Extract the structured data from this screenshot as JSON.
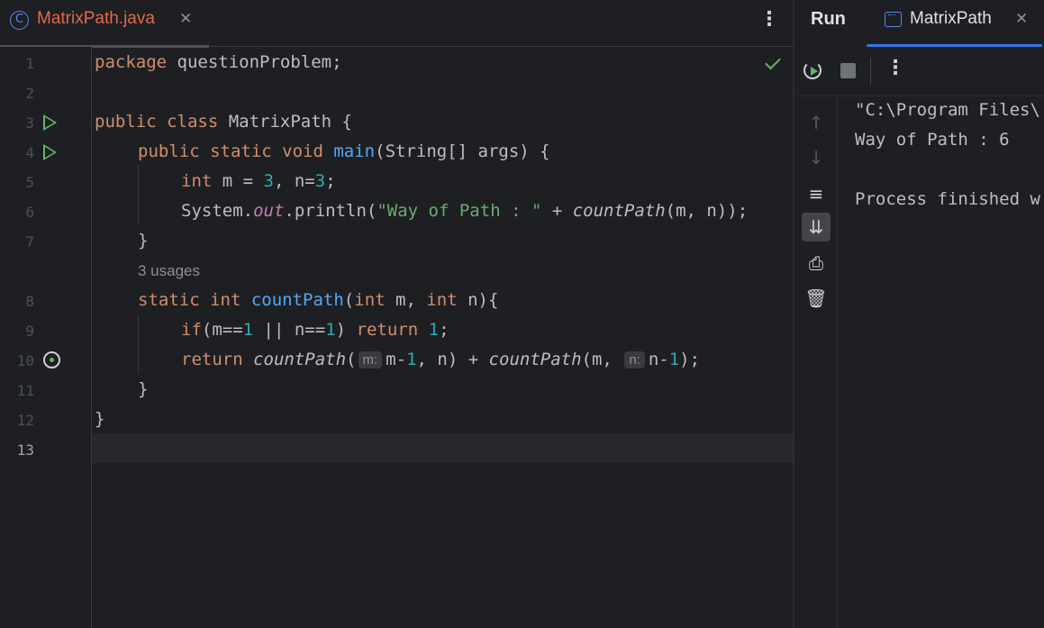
{
  "editor": {
    "file_tab": {
      "icon_letter": "C",
      "name": "MatrixPath.java",
      "close": "✕"
    },
    "menu": "⋮",
    "line_numbers": [
      "1",
      "2",
      "3",
      "4",
      "5",
      "6",
      "7",
      "8",
      "9",
      "10",
      "11",
      "12",
      "13"
    ],
    "code": {
      "l1": {
        "kw": "package",
        "rest": " questionProblem;"
      },
      "l3": {
        "kw": "public class",
        "rest": " MatrixPath {"
      },
      "l4": {
        "kw": "public static void",
        "fn": "main",
        "rest": "(String[] args) {"
      },
      "l5": {
        "kw": "int",
        "a": " m = ",
        "n1": "3",
        "b": ", n=",
        "n2": "3",
        "c": ";"
      },
      "l6": {
        "a": "System.",
        "field": "out",
        "b": ".println(",
        "str": "\"Way of Path : \"",
        "c": " + ",
        "call": "countPath",
        "d": "(m, n));"
      },
      "l7": "}",
      "usages": "3 usages",
      "l8": {
        "kw1": "static int",
        "fn": "countPath",
        "a": "(",
        "kw2": "int",
        "b": " m, ",
        "kw3": "int",
        "c": " n){"
      },
      "l9": {
        "kw": "if",
        "a": "(m==",
        "n1": "1",
        "b": " || n==",
        "n2": "1",
        "c": ") ",
        "kw2": "return",
        "d": " ",
        "n3": "1",
        "e": ";"
      },
      "l10": {
        "kw": "return",
        "call1": "countPath",
        "a": "(",
        "hint1": "m:",
        "b": "m-",
        "n1": "1",
        "c": ", n) + ",
        "call2": "countPath",
        "d": "(m, ",
        "hint2": "n:",
        "e": "n-",
        "n2": "1",
        "f": ");"
      },
      "l11": "}",
      "l12": "}"
    }
  },
  "run_panel": {
    "title": "Run",
    "tab": {
      "name": "MatrixPath",
      "close": "✕"
    },
    "toolbar": {
      "rerun": "rerun-icon",
      "stop": "stop-icon",
      "more": "⋮"
    },
    "side_icons": {
      "up": "↑",
      "down": "↓",
      "wrap": "≡",
      "scroll_end": "⇊",
      "print": "⎙",
      "trash": "🗑"
    },
    "console": [
      "\"C:\\Program Files\\",
      "Way of Path : 6",
      "",
      "Process finished w"
    ]
  }
}
